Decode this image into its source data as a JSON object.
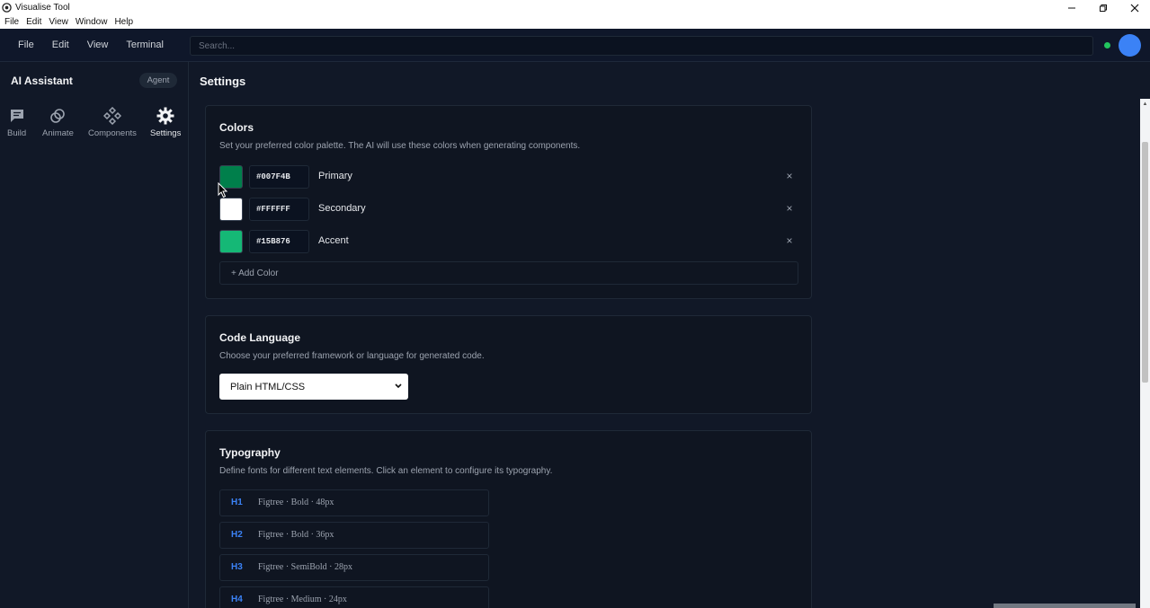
{
  "window": {
    "title": "Visualise Tool",
    "menu": [
      "File",
      "Edit",
      "View",
      "Window",
      "Help"
    ]
  },
  "topbar": {
    "menu": [
      "File",
      "Edit",
      "View",
      "Terminal"
    ],
    "search_placeholder": "Search...",
    "status_color": "#22c55e",
    "avatar_color": "#3b82f6"
  },
  "sidebar": {
    "title": "AI Assistant",
    "badge": "Agent",
    "items": [
      {
        "label": "Build",
        "icon": "chat-icon"
      },
      {
        "label": "Animate",
        "icon": "link-icon"
      },
      {
        "label": "Components",
        "icon": "components-icon"
      },
      {
        "label": "Settings",
        "icon": "gear-icon",
        "active": true
      }
    ]
  },
  "main": {
    "title": "Settings",
    "colors": {
      "title": "Colors",
      "description": "Set your preferred color palette. The AI will use these colors when generating components.",
      "items": [
        {
          "hex": "#007F4B",
          "name": "Primary"
        },
        {
          "hex": "#FFFFFF",
          "name": "Secondary"
        },
        {
          "hex": "#15B876",
          "name": "Accent"
        }
      ],
      "remove_label": "×",
      "add_label": "+ Add Color"
    },
    "code_language": {
      "title": "Code Language",
      "description": "Choose your preferred framework or language for generated code.",
      "selected": "Plain HTML/CSS"
    },
    "typography": {
      "title": "Typography",
      "description": "Define fonts for different text elements. Click an element to configure its typography.",
      "items": [
        {
          "tag": "H1",
          "spec": "Figtree · Bold · 48px"
        },
        {
          "tag": "H2",
          "spec": "Figtree · Bold · 36px"
        },
        {
          "tag": "H3",
          "spec": "Figtree · SemiBold · 28px"
        },
        {
          "tag": "H4",
          "spec": "Figtree · Medium · 24px"
        }
      ]
    }
  }
}
